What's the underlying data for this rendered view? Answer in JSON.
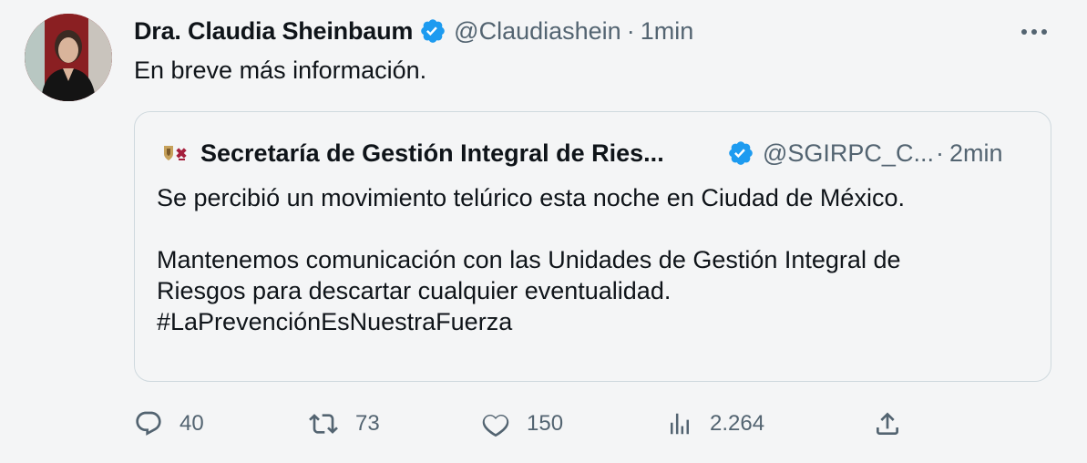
{
  "tweet": {
    "author_name": "Dra. Claudia Sheinbaum",
    "author_handle": "@Claudiashein",
    "separator": "·",
    "time": "1min",
    "text": "En breve más información."
  },
  "quoted": {
    "author_name": "Secretaría de Gestión Integral de Ries...",
    "author_handle": "@SGIRPC_C...",
    "separator": "·",
    "time": "2min",
    "lines": [
      "Se percibió un movimiento telúrico esta noche en Ciudad de México.",
      "Mantenemos comunicación con las Unidades de Gestión Integral de",
      "Riesgos para descartar cualquier eventualidad.",
      "#LaPrevenciónEsNuestraFuerza"
    ]
  },
  "actions": {
    "replies": "40",
    "retweets": "73",
    "likes": "150",
    "views": "2.264"
  },
  "colors": {
    "verified": "#1d9bf0",
    "secondary_text": "#536471",
    "primary_text": "#0f1419",
    "border": "#cfd9de"
  },
  "icons": [
    "verified-badge-icon",
    "more-icon",
    "reply-icon",
    "retweet-icon",
    "like-icon",
    "views-icon",
    "share-icon"
  ]
}
